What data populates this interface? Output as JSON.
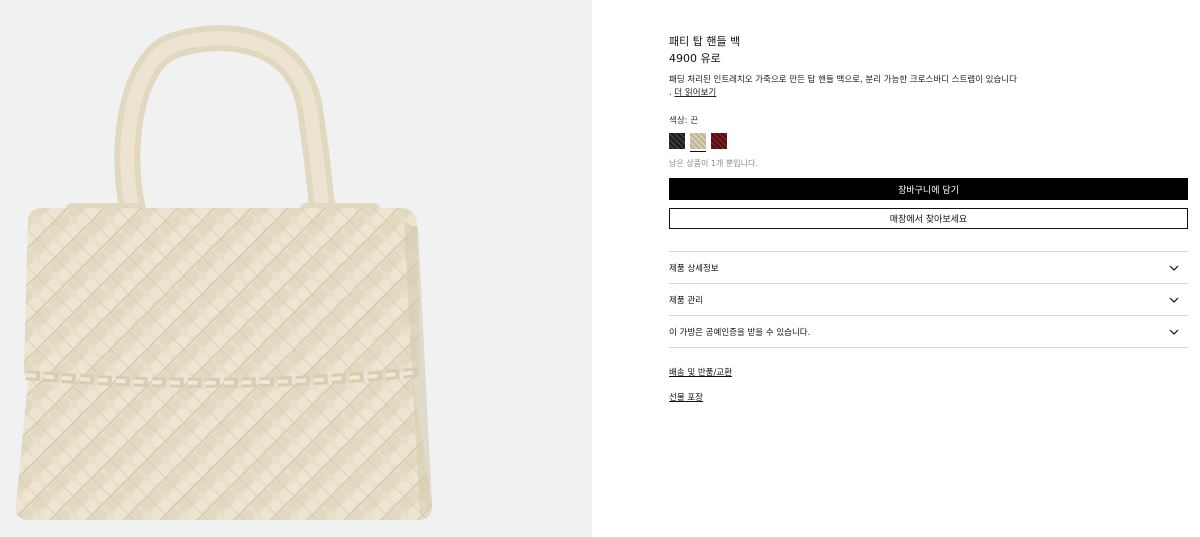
{
  "product": {
    "image_alt": "cream woven top handle bag",
    "title": "패티 탑 핸들 백",
    "price": "4900 유로",
    "description": "패딩 처리된 인트레치오 가죽으로 만든 탑 핸들 백으로, 분리 가능한 크로스바디 스트랩이 있습니다",
    "read_more_prefix": ".",
    "read_more": "더 읽어보기",
    "color_label": "색상: 끈",
    "swatches": [
      {
        "name": "black",
        "color": "#1a1a1a"
      },
      {
        "name": "cream",
        "color": "#d8cdb5",
        "selected": true
      },
      {
        "name": "red",
        "color": "#7a1c20"
      }
    ],
    "stock_note": "남은 상품이 1개 뿐입니다.",
    "add_to_cart": "장바구니에 담기",
    "find_in_store": "매장에서 찾아보세요"
  },
  "accordion": [
    {
      "label": "제품 상세정보"
    },
    {
      "label": "제품 관리"
    },
    {
      "label": "이 가방은 공예인증을 받을 수 있습니다."
    }
  ],
  "links": {
    "shipping": "배송 및 반품/교환",
    "gift": "선물 포장"
  },
  "colors": {
    "panel_bg": "#f0f1f1",
    "bag": "#e6dcc6",
    "button": "#000000"
  }
}
